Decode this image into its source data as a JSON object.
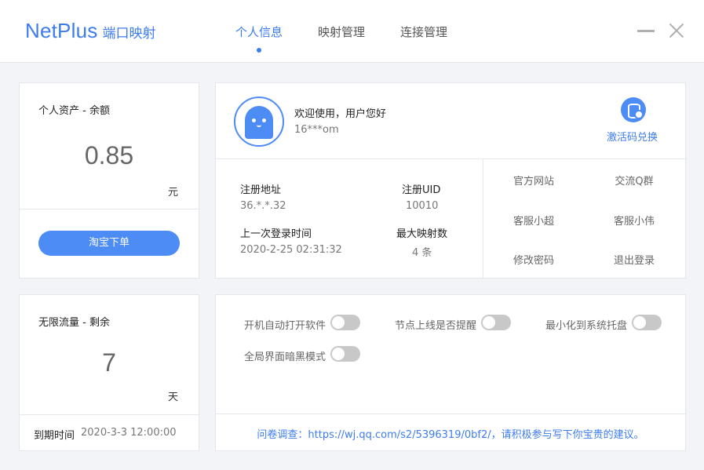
{
  "header": {
    "brand_name": "NetPlus",
    "brand_sub": "端口映射",
    "tabs": [
      {
        "label": "个人信息",
        "active": true
      },
      {
        "label": "映射管理",
        "active": false
      },
      {
        "label": "连接管理",
        "active": false
      }
    ],
    "window_controls": {
      "minimize_icon": "minimize-icon",
      "close_icon": "close-icon"
    }
  },
  "balance_card": {
    "title": "个人资产 - 余额",
    "value": "0.85",
    "unit": "元",
    "button_label": "淘宝下单"
  },
  "traffic_card": {
    "title": "无限流量 - 剩余",
    "value": "7",
    "unit": "天",
    "expire_label": "到期时间",
    "expire_value": "2020-3-3 12:00:00"
  },
  "profile": {
    "welcome": "欢迎使用，用户您好",
    "username": "16***om",
    "avatar_icon": "ghost-avatar-icon",
    "redeem_icon": "database-coin-icon",
    "redeem_label": "激活码兑换",
    "info": {
      "register_addr_label": "注册地址",
      "register_addr_value": "36.*.*.32",
      "uid_label": "注册UID",
      "uid_value": "10010",
      "last_login_label": "上一次登录时间",
      "last_login_value": "2020-2-25 02:31:32",
      "max_map_label": "最大映射数",
      "max_map_value": "4 条"
    },
    "links": [
      "官方网站",
      "交流Q群",
      "客服小超",
      "客服小伟",
      "修改密码",
      "退出登录"
    ]
  },
  "settings": {
    "options": [
      {
        "label": "开机自动打开软件",
        "enabled": false
      },
      {
        "label": "节点上线是否提醒",
        "enabled": false
      },
      {
        "label": "最小化到系统托盘",
        "enabled": false
      },
      {
        "label": "全局界面暗黑模式",
        "enabled": false
      }
    ],
    "survey": "问卷调查：https://wj.qq.com/s2/5396319/0bf2/，请积极参与写下你宝贵的建议。"
  },
  "colors": {
    "accent": "#3d7cf0",
    "button": "#4d8bf5",
    "toggle_off": "#c8c8c8",
    "background": "#f2f4f7"
  }
}
